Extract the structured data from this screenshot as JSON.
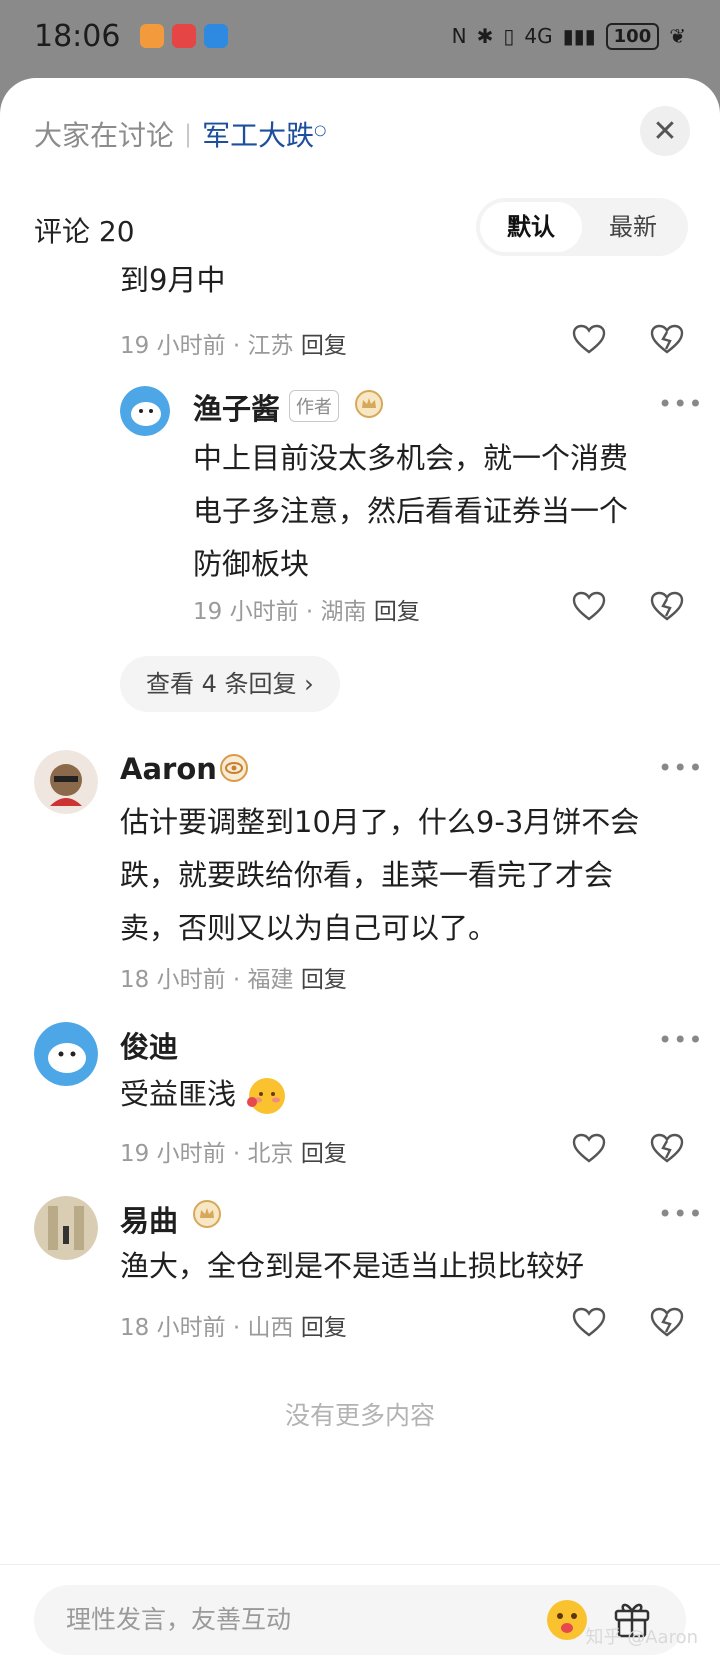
{
  "status_bar": {
    "time": "18:06",
    "battery": "100",
    "network": "4G"
  },
  "header": {
    "context": "大家在讨论",
    "topic": "军工大跌",
    "close_icon": "close-icon"
  },
  "comments_header": {
    "title": "评论 20",
    "sort_default": "默认",
    "sort_latest": "最新"
  },
  "comments": [
    {
      "text": "到9月中",
      "time": "19 小时前",
      "location": "江苏",
      "reply": "回复"
    },
    {
      "user": "渔子酱",
      "tag": "作者",
      "lines": [
        "中上目前没太多机会，就一个消费",
        "电子多注意，然后看看证券当一个",
        "防御板块"
      ],
      "time": "19 小时前",
      "location": "湖南",
      "reply": "回复"
    },
    {
      "user": "Aaron",
      "lines": [
        "估计要调整到10月了，什么9-3月饼不会",
        "跌，就要跌给你看，韭菜一看完了才会",
        "卖，否则又以为自己可以了。"
      ],
      "time": "18 小时前",
      "location": "福建",
      "reply": "回复"
    },
    {
      "user": "俊迪",
      "text": "受益匪浅",
      "time": "19 小时前",
      "location": "北京",
      "reply": "回复"
    },
    {
      "user": "易曲",
      "text": "渔大，全仓到是不是适当止损比较好",
      "time": "18 小时前",
      "location": "山西",
      "reply": "回复"
    }
  ],
  "view_replies": "查看 4 条回复 ›",
  "no_more": "没有更多内容",
  "input": {
    "placeholder": "理性发言，友善互动"
  },
  "watermark": "知乎 @Aaron"
}
